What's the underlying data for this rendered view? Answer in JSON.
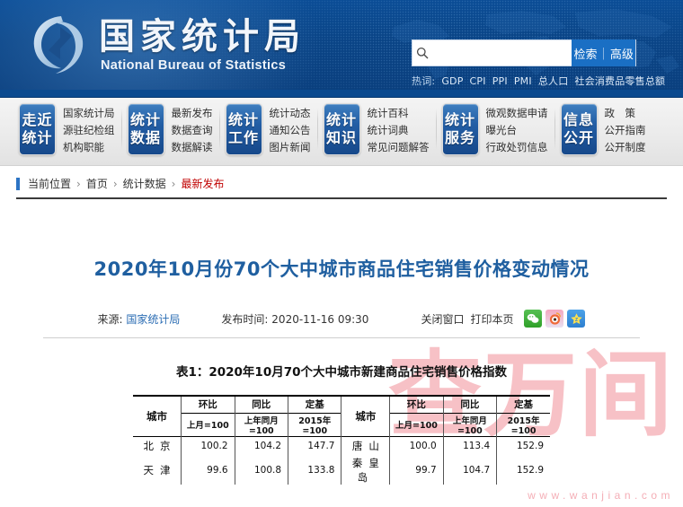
{
  "site": {
    "brand_cn": "国家统计局",
    "brand_en": "National Bureau of Statistics",
    "logo_icon": "nbs-swirl-logo-icon"
  },
  "search": {
    "icon": "search-icon",
    "value": "",
    "placeholder": "",
    "button_primary": "检索",
    "button_separator": "|",
    "button_secondary": "高级"
  },
  "hotwords": {
    "label": "热词:",
    "items": [
      "GDP",
      "CPI",
      "PPI",
      "PMI",
      "总人口",
      "社会消费品零售总额"
    ]
  },
  "nav": {
    "groups": [
      {
        "badge_top": "走近",
        "badge_bottom": "统计",
        "links": [
          "国家统计局",
          "源驻纪检组",
          "机构职能"
        ]
      },
      {
        "badge_top": "统计",
        "badge_bottom": "数据",
        "links": [
          "最新发布",
          "数据查询",
          "数据解读"
        ]
      },
      {
        "badge_top": "统计",
        "badge_bottom": "工作",
        "links": [
          "统计动态",
          "通知公告",
          "图片新闻"
        ]
      },
      {
        "badge_top": "统计",
        "badge_bottom": "知识",
        "links": [
          "统计百科",
          "统计词典",
          "常见问题解答"
        ]
      },
      {
        "badge_top": "统计",
        "badge_bottom": "服务",
        "links": [
          "微观数据申请",
          "曝光台",
          "行政处罚信息"
        ]
      },
      {
        "badge_top": "信息",
        "badge_bottom": "公开",
        "links": [
          "政　策",
          "公开指南",
          "公开制度"
        ]
      }
    ]
  },
  "breadcrumb": {
    "label": "当前位置",
    "sep": "›",
    "items": [
      "首页",
      "统计数据"
    ],
    "current": "最新发布"
  },
  "article": {
    "title": "2020年10月份70个大中城市商品住宅销售价格变动情况",
    "source_label": "来源:",
    "source_value": "国家统计局",
    "time_label": "发布时间:",
    "time_value": "2020-11-16  09:30",
    "close_window": "关闭窗口",
    "print_page": "打印本页",
    "share_icons": [
      "wechat-share-icon",
      "weibo-share-icon",
      "qzone-share-icon"
    ]
  },
  "table": {
    "caption": "表1：2020年10月70个大中城市新建商品住宅销售价格指数",
    "headers": {
      "city": "城市",
      "groups": [
        "环比",
        "同比",
        "定基"
      ],
      "units": [
        "上月=100",
        "上年同月=100",
        "2015年=100"
      ]
    },
    "rows": [
      {
        "left_city": "北京",
        "left_values": [
          "100.2",
          "104.2",
          "147.7"
        ],
        "right_city": "唐山",
        "right_values": [
          "100.0",
          "113.4",
          "152.9"
        ]
      },
      {
        "left_city": "天津",
        "left_values": [
          "99.6",
          "100.8",
          "133.8"
        ],
        "right_city": "秦皇岛",
        "right_values": [
          "99.7",
          "104.7",
          "152.9"
        ]
      }
    ]
  },
  "watermark": {
    "text": "查万间",
    "url": "www.wanjian.com",
    "color": "#f6b7bd"
  },
  "colors": {
    "header_blue": "#0a4486",
    "nav_badge_blue": "#235ea5",
    "title_blue": "#1f5fa0",
    "breadcrumb_current_red": "#c00000",
    "accent_button": "#1a6fc4"
  }
}
